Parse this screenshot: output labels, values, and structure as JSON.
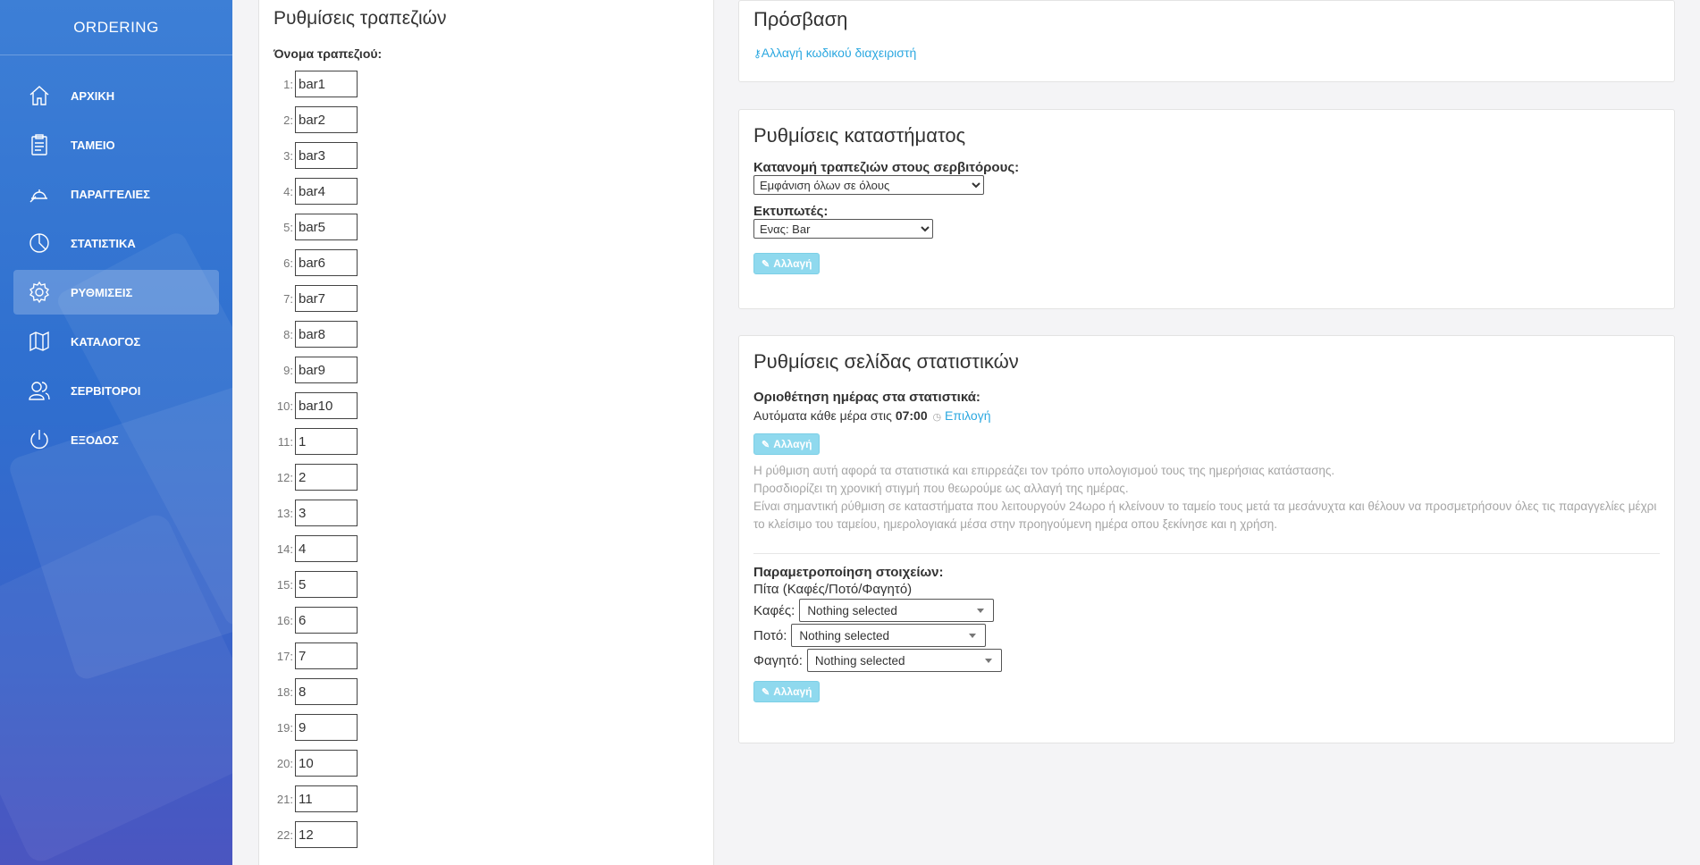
{
  "brand": "ORDERING",
  "nav": [
    {
      "label": "ΑΡΧΙΚΗ",
      "icon": "home-icon"
    },
    {
      "label": "ΤΑΜΕΙΟ",
      "icon": "clipboard-icon"
    },
    {
      "label": "ΠΑΡΑΓΓΕΛΙΕΣ",
      "icon": "service-bell-icon"
    },
    {
      "label": "ΣΤΑΤΙΣΤΙΚΑ",
      "icon": "pie-chart-icon"
    },
    {
      "label": "ΡΥΘΜΙΣΕΙΣ",
      "icon": "gear-icon",
      "active": true
    },
    {
      "label": "ΚΑΤΑΛΟΓΟΣ",
      "icon": "map-icon"
    },
    {
      "label": "ΣΕΡΒΙΤΟΡΟΙ",
      "icon": "users-icon"
    },
    {
      "label": "ΕΞΟΔΟΣ",
      "icon": "power-icon"
    }
  ],
  "tables_panel": {
    "title": "Ρυθμίσεις τραπεζιών",
    "name_label": "Όνομα τραπεζιού:",
    "rows": [
      {
        "num": "1:",
        "value": "bar1"
      },
      {
        "num": "2:",
        "value": "bar2"
      },
      {
        "num": "3:",
        "value": "bar3"
      },
      {
        "num": "4:",
        "value": "bar4"
      },
      {
        "num": "5:",
        "value": "bar5"
      },
      {
        "num": "6:",
        "value": "bar6"
      },
      {
        "num": "7:",
        "value": "bar7"
      },
      {
        "num": "8:",
        "value": "bar8"
      },
      {
        "num": "9:",
        "value": "bar9"
      },
      {
        "num": "10:",
        "value": "bar10"
      },
      {
        "num": "11:",
        "value": "1"
      },
      {
        "num": "12:",
        "value": "2"
      },
      {
        "num": "13:",
        "value": "3"
      },
      {
        "num": "14:",
        "value": "4"
      },
      {
        "num": "15:",
        "value": "5"
      },
      {
        "num": "16:",
        "value": "6"
      },
      {
        "num": "17:",
        "value": "7"
      },
      {
        "num": "18:",
        "value": "8"
      },
      {
        "num": "19:",
        "value": "9"
      },
      {
        "num": "20:",
        "value": "10"
      },
      {
        "num": "21:",
        "value": "11"
      },
      {
        "num": "22:",
        "value": "12"
      }
    ]
  },
  "access": {
    "title": "Πρόσβαση",
    "change_password_link": "Αλλαγή κωδικού διαχειριστή"
  },
  "store": {
    "title": "Ρυθμίσεις καταστήματος",
    "distribution_label": "Κατανομή τραπεζιών στους σερβιτόρους:",
    "distribution_value": "Εμφάνιση όλων σε όλους",
    "printers_label": "Εκτυπωτές:",
    "printers_value": "Ενας: Bar",
    "change_button": "Αλλαγή"
  },
  "stats": {
    "title": "Ρυθμίσεις σελίδας στατιστικών",
    "day_label": "Οριοθέτηση ημέρας στα στατιστικά:",
    "day_text": "Αυτόματα κάθε μέρα στις",
    "day_time": "07:00",
    "choose_link": "Επιλογή",
    "change_button": "Αλλαγή",
    "help_1": "Η ρύθμιση αυτή αφορά τα στατιστικά και επιρρεάζει τον τρόπο υπολογισμού τους της ημερήσιας κατάστασης.",
    "help_2": "Προσδιορίζει τη χρονική στιγμή που θεωρούμε ως αλλαγή της ημέρας.",
    "help_3": "Είναι σημαντική ρύθμιση σε καταστήματα που λειτουργούν 24ωρο ή κλείνουν το ταμείο τους μετά τα μεσάνυχτα και θέλουν να προσμετρήσουν όλες τις παραγγελίες μέχρι το κλείσιμο του ταμείου, ημερολογιακά μέσα στην προηγούμενη ημέρα οπου ξεκίνησε και η χρήση.",
    "params_label": "Παραμετροποίηση στοιχείων:",
    "pie_label": "Πίτα (Καφές/Ποτό/Φαγητό)",
    "coffee_label": "Καφές:",
    "drink_label": "Ποτό:",
    "food_label": "Φαγητό:",
    "nothing_selected": "Nothing selected",
    "change_button_2": "Αλλαγή"
  }
}
